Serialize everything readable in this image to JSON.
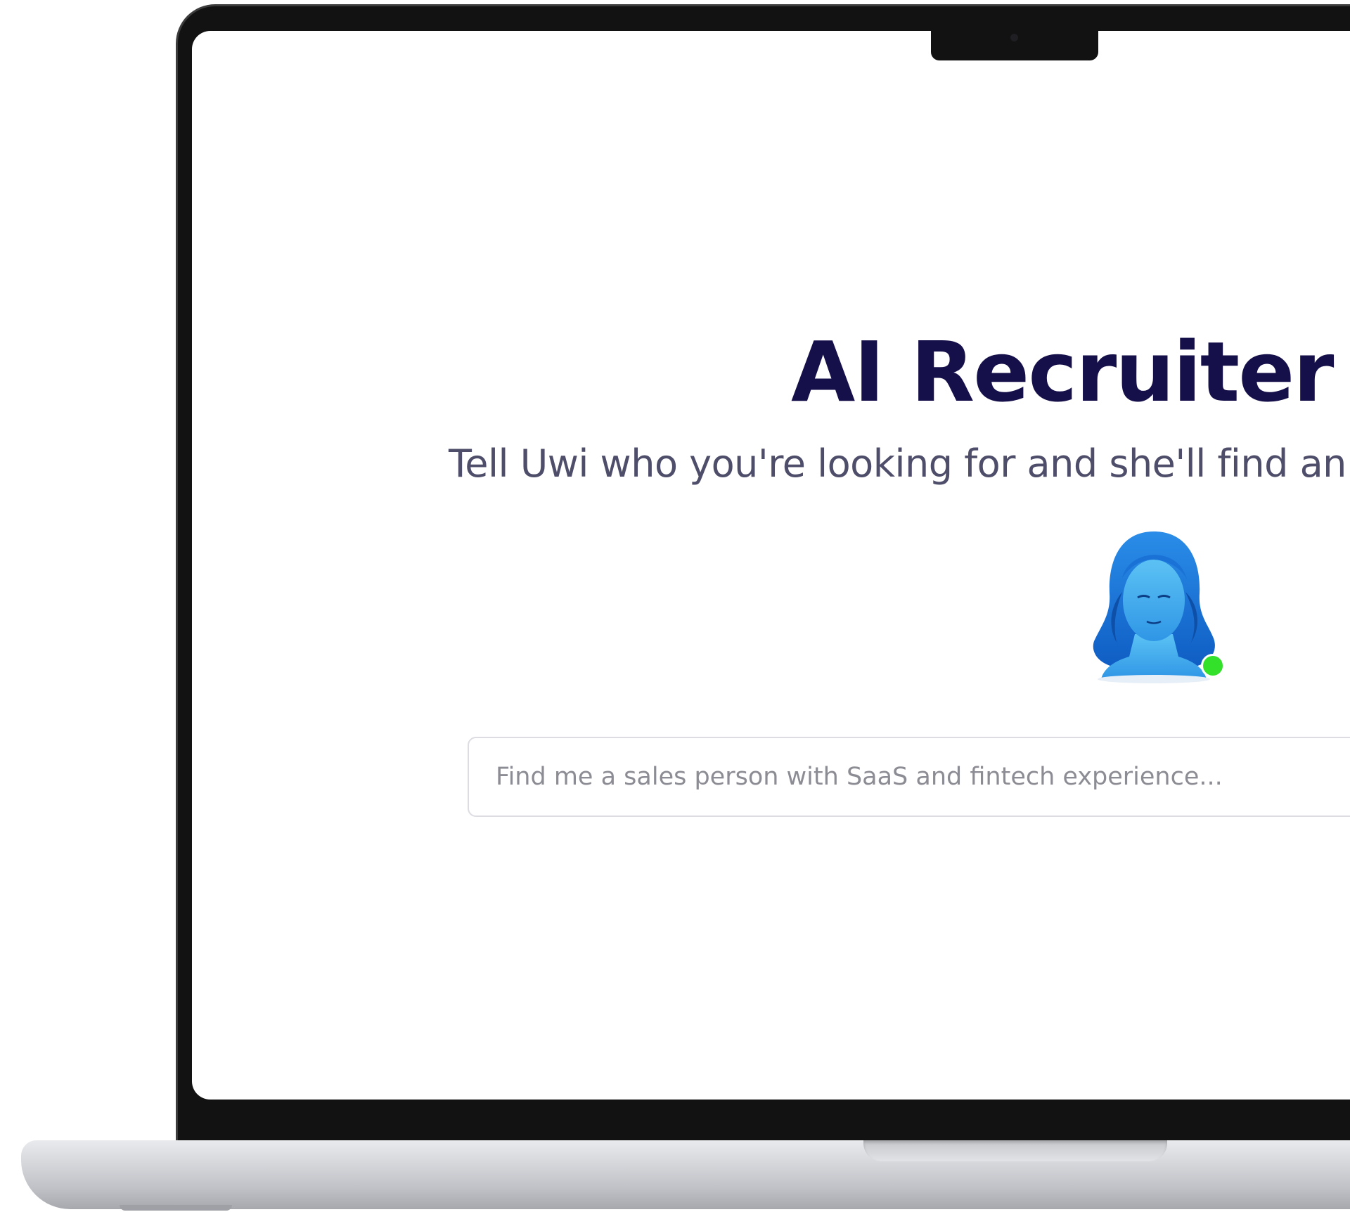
{
  "hero": {
    "title": "AI Recruiter",
    "subtitle": "Tell Uwi who you're looking for and she'll find an"
  },
  "avatar": {
    "icon": "woman-portrait-icon",
    "status": "online",
    "status_color": "#33e02a"
  },
  "search": {
    "placeholder": "Find me a sales person with SaaS and fintech experience...",
    "value": ""
  },
  "colors": {
    "title": "#16104a",
    "subtitle": "#4e4d6a",
    "avatar_primary": "#1e7fe0"
  }
}
